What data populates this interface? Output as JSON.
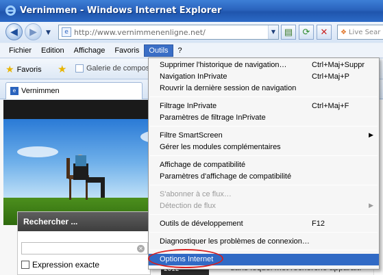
{
  "window": {
    "title": "Vernimmen - Windows Internet Explorer"
  },
  "address": {
    "url": "http://www.vernimmenenligne.net/",
    "search_placeholder": "Live Sear"
  },
  "menubar": {
    "items": [
      "Fichier",
      "Edition",
      "Affichage",
      "Favoris",
      "Outils",
      "?"
    ]
  },
  "favorites": {
    "label": "Favoris",
    "galerie": "Galerie de compos"
  },
  "tab": {
    "label": "Vernimmen"
  },
  "page": {
    "search_title": "Rechercher ...",
    "checkbox_label": "Expression exacte",
    "body_text": "dans lequel mot recherche apparait.",
    "book_text": "D'ENTREPRISE 2012"
  },
  "dropdown": {
    "items": [
      {
        "label": "Supprimer l'historique de navigation…",
        "shortcut": "Ctrl+Maj+Suppr"
      },
      {
        "label": "Navigation InPrivate",
        "shortcut": "Ctrl+Maj+P"
      },
      {
        "label": "Rouvrir la dernière session de navigation",
        "shortcut": ""
      },
      {
        "label": "Filtrage InPrivate",
        "shortcut": "Ctrl+Maj+F"
      },
      {
        "label": "Paramètres de filtrage InPrivate",
        "shortcut": ""
      },
      {
        "label": "Filtre SmartScreen",
        "shortcut": ""
      },
      {
        "label": "Gérer les modules complémentaires",
        "shortcut": ""
      },
      {
        "label": "Affichage de compatibilité",
        "shortcut": ""
      },
      {
        "label": "Paramètres d'affichage de compatibilité",
        "shortcut": ""
      },
      {
        "label": "S'abonner à ce flux…",
        "shortcut": ""
      },
      {
        "label": "Détection de flux",
        "shortcut": ""
      },
      {
        "label": "Outils de développement",
        "shortcut": "F12"
      },
      {
        "label": "Diagnostiquer les problèmes de connexion…",
        "shortcut": ""
      },
      {
        "label": "Options Internet",
        "shortcut": ""
      }
    ]
  },
  "colors": {
    "titlebar": "#2a63bd",
    "menu_highlight": "#316ac5",
    "annotation_ring": "#d62020"
  }
}
